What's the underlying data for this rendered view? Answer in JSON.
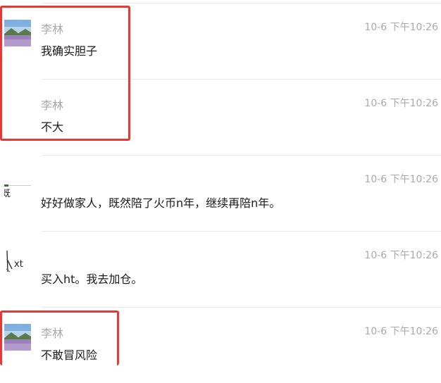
{
  "messages": [
    {
      "sender": "李林",
      "time": "10-6 下午10:26",
      "text": "我确实胆子",
      "avatar": "landscape-avatar"
    },
    {
      "sender": "李林",
      "time": "10-6 下午10:26",
      "text": "不大",
      "avatar": ""
    },
    {
      "sender": "",
      "time": "10-6 下午10:26",
      "text": "好好做家人，既然陪了火币n年，继续再陪n年。",
      "avatar": "text-avatar",
      "avatar_text": "既"
    },
    {
      "sender": "",
      "time": "10-6 下午10:26",
      "text": "买入ht。我去加仓。",
      "avatar": "sketch-avatar",
      "avatar_text": "xt"
    },
    {
      "sender": "李林",
      "time": "10-6 下午10:26",
      "text": "不敢冒风险",
      "avatar": "landscape-avatar"
    }
  ],
  "colors": {
    "highlight": "#e53935",
    "sender": "#a9a9a9",
    "time": "#aaaaaa",
    "text": "#1a1a1a"
  }
}
